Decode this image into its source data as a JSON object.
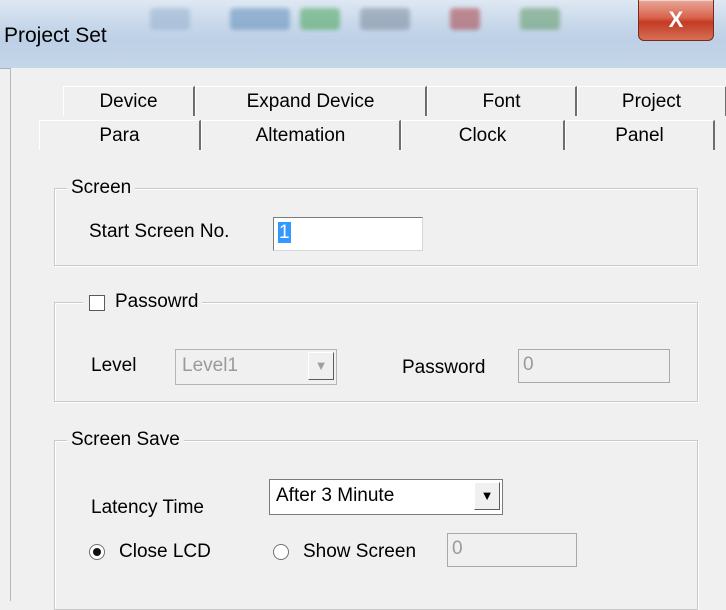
{
  "window": {
    "title": "Project Set",
    "close_glyph": "X"
  },
  "tabs": {
    "row1": [
      "Device",
      "Expand Device",
      "Font",
      "Project"
    ],
    "row2": [
      "Para",
      "Altemation",
      "Clock",
      "Panel"
    ],
    "active": "Para"
  },
  "screen": {
    "legend": "Screen",
    "start_label": "Start Screen No.",
    "start_value": "1"
  },
  "password": {
    "legend": "Passowrd",
    "checked": false,
    "level_label": "Level",
    "level_value": "Level1",
    "password_label": "Password",
    "password_value": "0"
  },
  "screen_save": {
    "legend": "Screen Save",
    "latency_label": "Latency Time",
    "latency_value": "After 3 Minute",
    "close_lcd_label": "Close LCD",
    "show_screen_label": "Show Screen",
    "show_screen_value": "0",
    "selected": "Close LCD"
  },
  "icons": {
    "close": "close-icon",
    "dropdown": "chevron-down-icon"
  }
}
